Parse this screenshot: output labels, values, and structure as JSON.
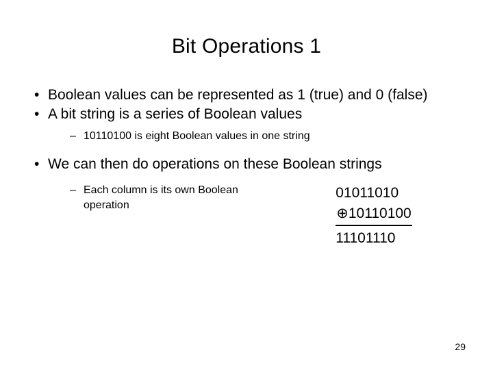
{
  "slide": {
    "title": "Bit Operations 1",
    "bullets": [
      {
        "level": 1,
        "marker": "•",
        "text": "Boolean values can be represented as 1 (true) and 0 (false)"
      },
      {
        "level": 1,
        "marker": "•",
        "text": "A bit string is a series of Boolean values"
      },
      {
        "level": 2,
        "marker": "–",
        "text": "10110100 is eight Boolean values in one string"
      },
      {
        "level": 1,
        "marker": "•",
        "text": "We can then do operations on these Boolean strings"
      }
    ],
    "sub_bullet": {
      "marker": "–",
      "line1": "Each column is its own",
      "line2": "Boolean operation"
    },
    "bit_math": {
      "operand1": "01011010",
      "operator": "⊕",
      "operand2": "10110100",
      "result": "11101110"
    },
    "page_number": "29"
  }
}
